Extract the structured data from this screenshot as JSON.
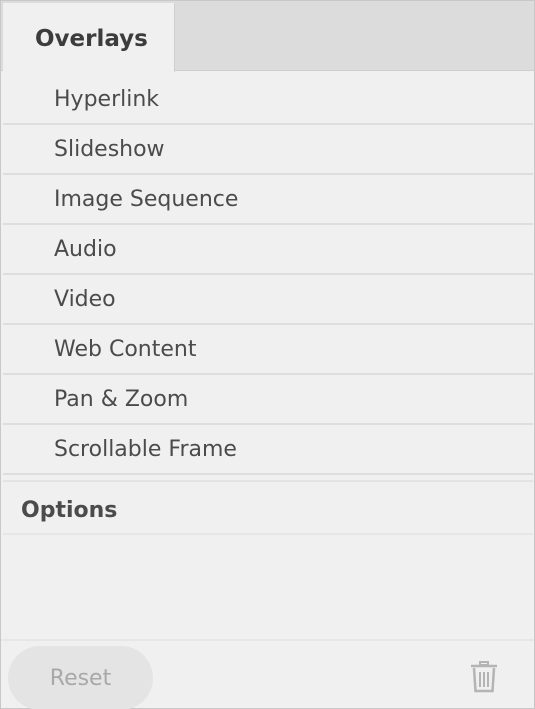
{
  "tabs": [
    {
      "label": "Overlays"
    }
  ],
  "overlays": {
    "items": [
      {
        "label": "Hyperlink"
      },
      {
        "label": "Slideshow"
      },
      {
        "label": "Image Sequence"
      },
      {
        "label": "Audio"
      },
      {
        "label": "Video"
      },
      {
        "label": "Web Content"
      },
      {
        "label": "Pan & Zoom"
      },
      {
        "label": "Scrollable Frame"
      }
    ]
  },
  "options": {
    "title": "Options"
  },
  "footer": {
    "reset_label": "Reset",
    "delete_icon": "trash-icon"
  },
  "colors": {
    "background": "#f0f0f0",
    "tab_bar": "#dcdcdc",
    "text": "#4b4b4b",
    "disabled_text": "#a8a8a8",
    "separator": "#dedede"
  }
}
